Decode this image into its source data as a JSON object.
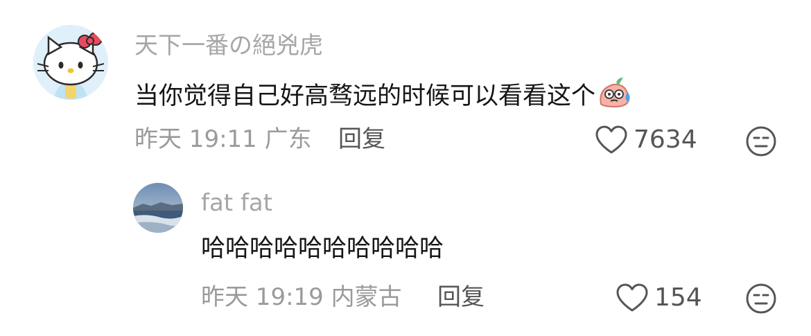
{
  "comments": [
    {
      "username": "天下一番の絕兇虎",
      "text": "当你觉得自己好高骛远的时候可以看看这个",
      "emoji": "sweat-face-emoji",
      "time": "昨天 19:11",
      "location": "广东",
      "reply_label": "回复",
      "likes": "7634"
    },
    {
      "username": "fat fat",
      "text": "哈哈哈哈哈哈哈哈哈哈",
      "time": "昨天 19:19",
      "location": "内蒙古",
      "reply_label": "回复",
      "likes": "154"
    }
  ],
  "icons": {
    "like": "heart-icon",
    "dislike": "meh-face-icon"
  },
  "colors": {
    "username": "#a6a6a6",
    "meta": "#9a9a9a",
    "text": "#161616",
    "icon": "#555555"
  }
}
